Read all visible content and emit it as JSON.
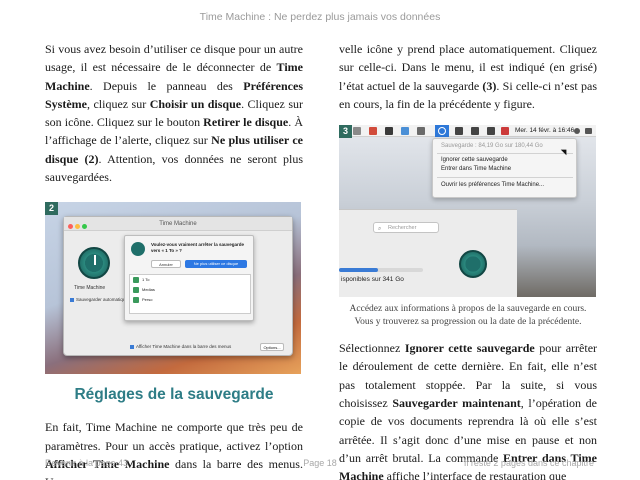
{
  "header": {
    "title": "Time Machine : Ne perdez plus jamais vos données"
  },
  "left_column": {
    "para1": [
      {
        "t": "Si vous avez besoin d’utiliser ce disque pour un autre usage, il est nécessaire de le déconnecter de ",
        "b": false
      },
      {
        "t": "Time Machine",
        "b": true
      },
      {
        "t": ". Depuis le panneau des ",
        "b": false
      },
      {
        "t": "Préférences Système",
        "b": true
      },
      {
        "t": ", cliquez sur ",
        "b": false
      },
      {
        "t": "Choisir un disque",
        "b": true
      },
      {
        "t": ". Cliquez sur son icône. Cliquez sur le bouton ",
        "b": false
      },
      {
        "t": "Retirer le disque",
        "b": true
      },
      {
        "t": ". À l’affichage de l’alerte, cliquez sur ",
        "b": false
      },
      {
        "t": "Ne plus utiliser ce disque (2)",
        "b": true
      },
      {
        "t": ". Attention, vos données ne seront plus sauvegardées.",
        "b": false
      }
    ],
    "figure": {
      "badge": "2",
      "window_title": "Time Machine",
      "app_label": "Time Machine",
      "auto_backup_label": "Sauvegarder automatiquement",
      "sheet_question": "Voulez-vous vraiment arrêter la sauvegarde vers « 1 To » ?",
      "cancel_button": "Annuler",
      "confirm_button": "Ne plus utiliser ce disque",
      "disks": [
        "1 To",
        "Medias",
        "Perso"
      ],
      "show_in_menubar": "Afficher Time Machine dans la barre des menus",
      "options_button": "Options..."
    },
    "heading": "Réglages de la sauvegarde",
    "para2": [
      {
        "t": "En fait, Time Machine ne comporte que très peu de paramètres. Pour un accès pratique, activez l’option ",
        "b": false
      },
      {
        "t": "Afficher Time Machine",
        "b": true
      },
      {
        "t": " dans la barre des menus. Une nou-",
        "b": false
      }
    ]
  },
  "right_column": {
    "para1": [
      {
        "t": "velle icône y prend place automatiquement. Cliquez sur celle-ci. Dans le menu, il est indiqué (en grisé) l’état actuel de la sauvegarde ",
        "b": false
      },
      {
        "t": "(3)",
        "b": true
      },
      {
        "t": ". Si celle-ci n’est pas en cours, la fin de la précédente y figure.",
        "b": false
      }
    ],
    "figure": {
      "badge": "3",
      "menubar_date": "Mer. 14 févr. à 16:46",
      "dropdown_status": "Sauvegarde : 84,19 Go sur 180,44 Go",
      "dropdown_items": [
        "Ignorer cette sauvegarde",
        "Entrer dans Time Machine",
        "Ouvrir les préférences Time Machine..."
      ],
      "search_placeholder": "Rechercher",
      "available_text": "isponibles sur 341 Go",
      "progress_fraction": 0.47
    },
    "caption": "Accédez aux informations à propos de la sauvegarde en cours. Vous y trouverez sa progression ou la date de la précédente.",
    "para2": [
      {
        "t": "Sélectionnez ",
        "b": false
      },
      {
        "t": "Ignorer cette sauvegarde",
        "b": true
      },
      {
        "t": " pour arrêter le déroulement de cette dernière. En fait, elle n’est pas totalement stoppée. Par la suite, si vous choisissez ",
        "b": false
      },
      {
        "t": "Sauvegarder maintenant",
        "b": true
      },
      {
        "t": ", l’opération de copie de vos documents reprendra là où elle s’est arrêtée. Il s’agit donc d’une mise en pause et non d’un arrêt brutal. La commande ",
        "b": false
      },
      {
        "t": "Entrer dans Time Machine",
        "b": true
      },
      {
        "t": " affiche l’interface de restauration que",
        "b": false
      }
    ]
  },
  "footer": {
    "back_link": "Revenir à la page 43",
    "page_number": "Page 18",
    "remaining": "Il reste 2 pages dans ce chapitre"
  },
  "colors": {
    "heading": "#2e7d86",
    "badge": "#2f6b5f",
    "accent_blue": "#2d78e3"
  }
}
